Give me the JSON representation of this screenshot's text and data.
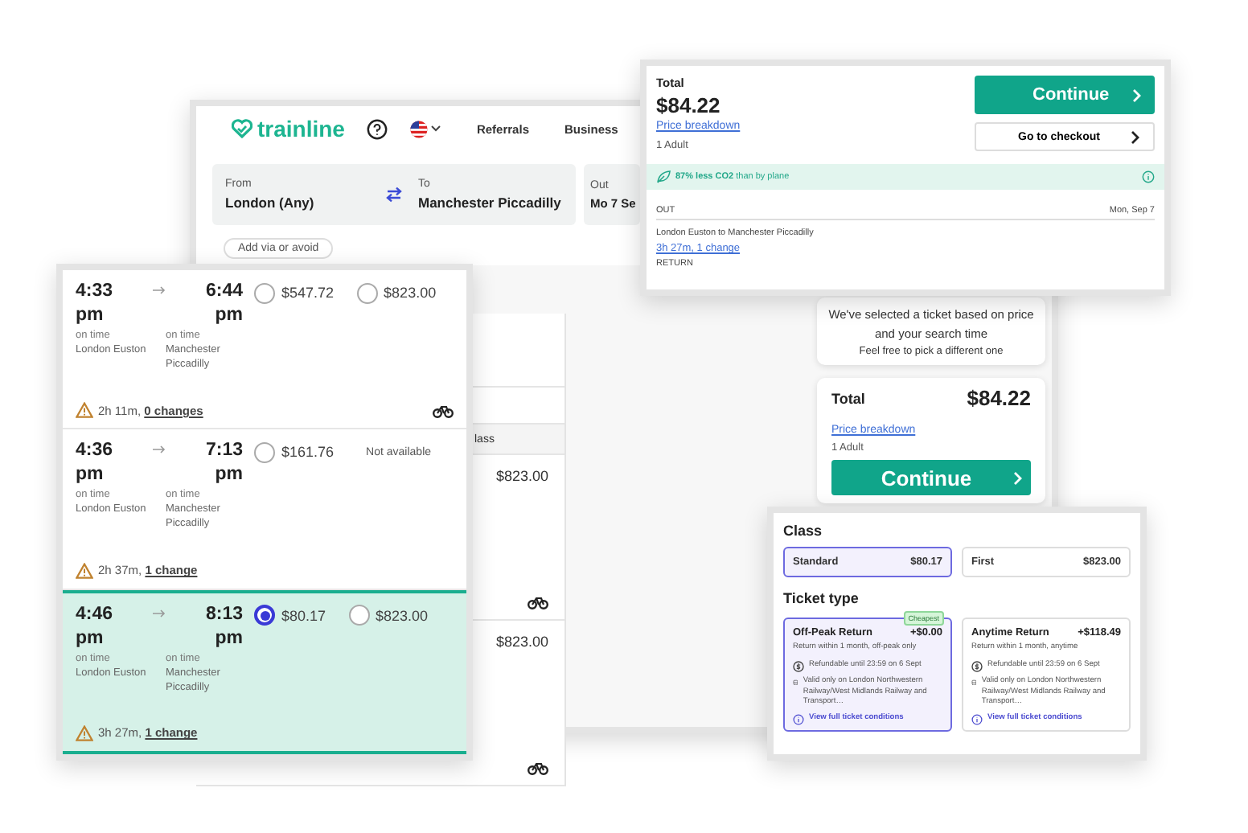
{
  "browser": {
    "logo": "trainline",
    "nav": [
      "Referrals",
      "Business"
    ],
    "search": [
      {
        "label": "From",
        "value": "London (Any)"
      },
      {
        "label": "To",
        "value": "Manchester Piccadilly"
      },
      {
        "label": "Out",
        "value": "Mo 7 Se"
      }
    ],
    "via_chip": "Add via or avoid",
    "results": {
      "header": "lass",
      "rows": [
        {
          "price": "$823.00",
          "bike": true
        },
        {
          "price": "$823.00",
          "bike": true
        }
      ]
    },
    "hint": {
      "main": "We've selected a ticket based on price and your search time",
      "sub": "Feel free to pick a different one"
    },
    "summary": {
      "total_label": "Total",
      "total": "$84.22",
      "breakdown": "Price breakdown",
      "passengers": "1 Adult",
      "continue": "Continue"
    }
  },
  "basket": {
    "total_label": "Total",
    "total": "$84.22",
    "breakdown": "Price breakdown",
    "passengers": "1 Adult",
    "continue": "Continue",
    "checkout": "Go to checkout",
    "co2": "**87% less CO2** than by plane",
    "out_label": "OUT",
    "out_date": "Mon, Sep 7",
    "route": "London Euston to Manchester Piccadilly",
    "duration": "3h 27m, 1 change",
    "return_label": "RETURN"
  },
  "journeys": [
    {
      "depart": "4:33 pm",
      "arrive": "6:44 pm",
      "depart_status": "on time",
      "arrive_status": "on time",
      "from": "London Euston",
      "to": "Manchester Piccadilly",
      "duration": "2h 11m,",
      "changes": "0 changes",
      "bike": true,
      "selected": false,
      "fares": [
        {
          "kind": "radio",
          "price": "$547.72",
          "selected": false
        },
        {
          "kind": "radio",
          "price": "$823.00",
          "selected": false
        }
      ]
    },
    {
      "depart": "4:36 pm",
      "arrive": "7:13 pm",
      "depart_status": "on time",
      "arrive_status": "on time",
      "from": "London Euston",
      "to": "Manchester Piccadilly",
      "duration": "2h 37m,",
      "changes": "1 change",
      "bike": false,
      "selected": false,
      "fares": [
        {
          "kind": "radio",
          "price": "$161.76",
          "selected": false
        },
        {
          "kind": "unavailable",
          "text": "Not available"
        }
      ]
    },
    {
      "depart": "4:46 pm",
      "arrive": "8:13 pm",
      "depart_status": "on time",
      "arrive_status": "on time",
      "from": "London Euston",
      "to": "Manchester Piccadilly",
      "duration": "3h 27m,",
      "changes": "1 change",
      "bike": false,
      "selected": true,
      "fares": [
        {
          "kind": "radio",
          "price": "$80.17",
          "selected": true
        },
        {
          "kind": "radio",
          "price": "$823.00",
          "selected": false
        }
      ]
    }
  ],
  "fares": {
    "class_title": "Class",
    "classes": [
      {
        "name": "Standard",
        "price": "$80.17",
        "selected": true
      },
      {
        "name": "First",
        "price": "$823.00",
        "selected": false
      }
    ],
    "ticket_title": "Ticket type",
    "tickets": [
      {
        "name": "Off-Peak Return",
        "price": "+$0.00",
        "badge": "Cheapest",
        "summary": "Return within 1 month, off-peak only",
        "refund": "Refundable until 23:59 on 6 Sept",
        "validity": "Valid only on London Northwestern Railway/West Midlands Railway and Transport…",
        "link": "View full ticket conditions",
        "selected": true
      },
      {
        "name": "Anytime Return",
        "price": "+$118.49",
        "summary": "Return within 1 month, anytime",
        "refund": "Refundable until 23:59 on 6 Sept",
        "validity": "Valid only on London Northwestern Railway/West Midlands Railway and Transport…",
        "link": "View full ticket conditions",
        "selected": false
      }
    ]
  }
}
